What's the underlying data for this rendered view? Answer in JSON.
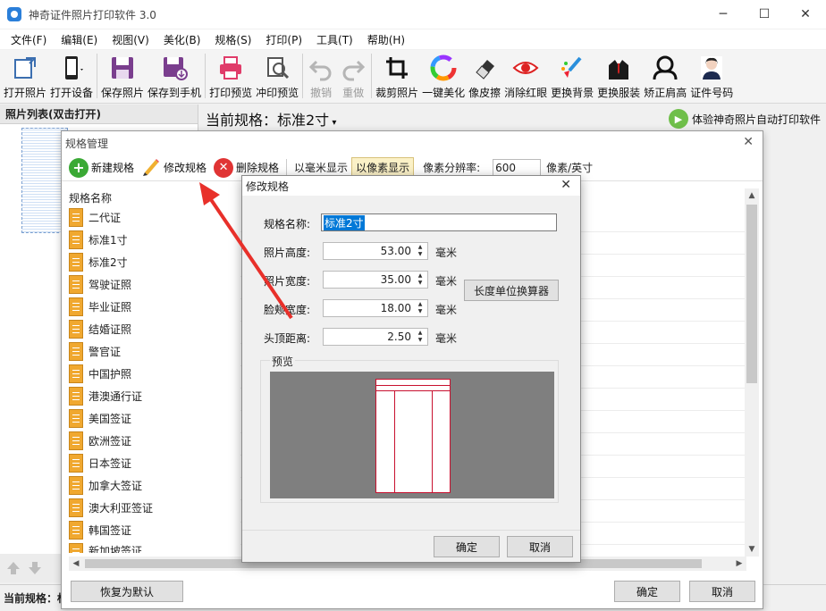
{
  "window": {
    "title": "神奇证件照片打印软件 3.0"
  },
  "menu": [
    "文件(F)",
    "编辑(E)",
    "视图(V)",
    "美化(B)",
    "规格(S)",
    "打印(P)",
    "工具(T)",
    "帮助(H)"
  ],
  "toolbar": {
    "open_photo": "打开照片",
    "open_device": "打开设备",
    "save_photo": "保存照片",
    "save_to_phone": "保存到手机",
    "print_preview": "打印预览",
    "wash_preview": "冲印预览",
    "undo": "撤销",
    "redo": "重做",
    "crop": "裁剪照片",
    "beautify": "一键美化",
    "eraser": "像皮擦",
    "red_eye": "消除红眼",
    "change_bg": "更换背景",
    "change_clothes": "更换服装",
    "fix_shoulders": "矫正肩高",
    "id_number": "证件号码"
  },
  "left_panel": {
    "header": "照片列表(双击打开)"
  },
  "main": {
    "current_spec": "当前规格：标准2寸",
    "promo": "体验神奇照片自动打印软件"
  },
  "statusbar": {
    "text": "当前规格：标"
  },
  "spec_dialog": {
    "title": "规格管理",
    "new": "新建规格",
    "modify": "修改规格",
    "delete": "删除规格",
    "mm_mode": "以毫米显示",
    "px_mode": "以像素显示",
    "resolution_label": "像素分辨率:",
    "resolution_value": "600",
    "resolution_unit": "像素/英寸",
    "list_header": "规格名称",
    "items": [
      "二代证",
      "标准1寸",
      "标准2寸",
      "驾驶证照",
      "毕业证照",
      "结婚证照",
      "警官证",
      "中国护照",
      "港澳通行证",
      "美国签证",
      "欧洲签证",
      "日本签证",
      "加拿大签证",
      "澳大利亚签证",
      "韩国签证",
      "新加坡签证"
    ],
    "reset": "恢复为默认",
    "ok": "确定",
    "cancel": "取消"
  },
  "modify_dialog": {
    "title": "修改规格",
    "name_label": "规格名称:",
    "name_value": "标准2寸",
    "height_label": "照片高度:",
    "height_value": "53.00",
    "width_label": "照片宽度:",
    "width_value": "35.00",
    "face_label": "脸颊宽度:",
    "face_value": "18.00",
    "top_label": "头顶距离:",
    "top_value": "2.50",
    "unit": "毫米",
    "calc_button": "长度单位换算器",
    "preview_label": "预览",
    "ok": "确定",
    "cancel": "取消"
  },
  "colors": {
    "accent_blue": "#0078d7",
    "frame_red": "#c8102e",
    "arrow_red": "#e8302a",
    "doc_orange": "#f0a830"
  }
}
